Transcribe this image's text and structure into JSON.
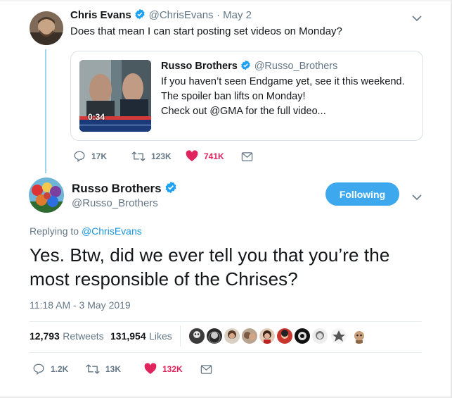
{
  "parent_tweet": {
    "author_name": "Chris Evans",
    "author_handle": "@ChrisEvans",
    "date": "· May 2",
    "text": "Does that mean I can start posting set videos on Monday?",
    "quoted": {
      "author_name": "Russo Brothers",
      "author_handle": "@Russo_Brothers",
      "line1": "If you haven’t seen Endgame yet, see it this weekend.",
      "line2": "The spoiler ban lifts on Monday!",
      "line3": "Check out @GMA for the full video...",
      "video_duration": "0:34"
    },
    "actions": {
      "replies": "17K",
      "retweets": "123K",
      "likes": "741K"
    }
  },
  "main_tweet": {
    "author_name": "Russo Brothers",
    "author_handle": "@Russo_Brothers",
    "follow_label": "Following",
    "replying_prefix": "Replying to",
    "replying_handle": "@ChrisEvans",
    "text_line1": "Yes. Btw, did we ever tell you that you’re the",
    "text_line2": "most responsible of the Chrises?",
    "timestamp": "11:18 AM - 3 May 2019",
    "stats": {
      "retweets_count": "12,793",
      "retweets_label": "Retweets",
      "likes_count": "131,954",
      "likes_label": "Likes"
    },
    "actions": {
      "replies": "1.2K",
      "retweets": "13K",
      "likes": "132K"
    }
  },
  "colors": {
    "accent": "#1da1f2",
    "like_heart": "#e0245e",
    "muted": "#657786",
    "thread_line": "#9fd3f0"
  },
  "icons": {
    "verified": "verified-badge-icon",
    "caret": "chevron-down-icon",
    "reply": "reply-icon",
    "retweet": "retweet-icon",
    "like": "heart-icon",
    "dm": "envelope-icon"
  }
}
